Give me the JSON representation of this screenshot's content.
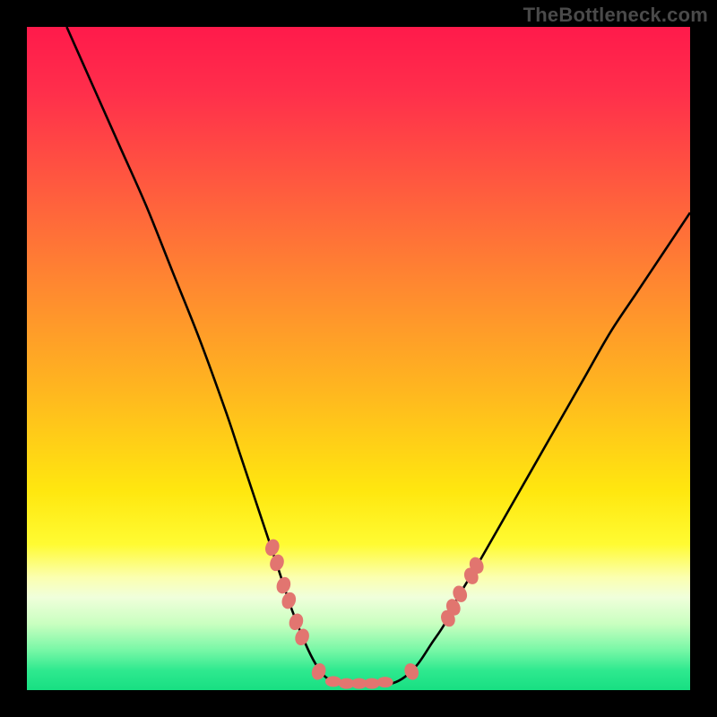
{
  "attribution": "TheBottleneck.com",
  "colors": {
    "frame": "#000000",
    "curve": "#000000",
    "marker_a": "#e27570",
    "marker_b": "#e1756f",
    "gradient_stops": [
      {
        "offset": 0.0,
        "color": "#ff1a4b"
      },
      {
        "offset": 0.1,
        "color": "#ff2f4b"
      },
      {
        "offset": 0.25,
        "color": "#ff5d3e"
      },
      {
        "offset": 0.4,
        "color": "#ff8b2f"
      },
      {
        "offset": 0.55,
        "color": "#ffb71f"
      },
      {
        "offset": 0.7,
        "color": "#ffe70f"
      },
      {
        "offset": 0.78,
        "color": "#fffb32"
      },
      {
        "offset": 0.83,
        "color": "#fbffb0"
      },
      {
        "offset": 0.86,
        "color": "#f0ffdb"
      },
      {
        "offset": 0.9,
        "color": "#c9ffc0"
      },
      {
        "offset": 0.94,
        "color": "#77f7a6"
      },
      {
        "offset": 0.97,
        "color": "#2fe98f"
      },
      {
        "offset": 1.0,
        "color": "#17df82"
      }
    ]
  },
  "chart_data": {
    "type": "line",
    "title": "",
    "xlabel": "",
    "ylabel": "",
    "xlim": [
      0,
      100
    ],
    "ylim": [
      0,
      100
    ],
    "series": [
      {
        "name": "curve-left",
        "x": [
          6,
          10,
          14,
          18,
          22,
          26,
          30,
          32,
          34,
          36,
          38,
          40,
          42,
          43.5,
          45
        ],
        "y": [
          100,
          91,
          82,
          73,
          63,
          53,
          42,
          36,
          30,
          24,
          18,
          12,
          7,
          4,
          2
        ]
      },
      {
        "name": "curve-bottom",
        "x": [
          45,
          47,
          49,
          51,
          53,
          55,
          57
        ],
        "y": [
          2,
          1,
          1,
          1,
          1,
          1,
          2
        ]
      },
      {
        "name": "curve-right",
        "x": [
          57,
          59,
          61,
          63,
          65,
          68,
          72,
          76,
          80,
          84,
          88,
          92,
          96,
          100
        ],
        "y": [
          2,
          4,
          7,
          10,
          14,
          19,
          26,
          33,
          40,
          47,
          54,
          60,
          66,
          72
        ]
      }
    ],
    "markers_left": [
      {
        "x": 37.0,
        "y": 21.5
      },
      {
        "x": 37.7,
        "y": 19.2
      },
      {
        "x": 38.7,
        "y": 15.8
      },
      {
        "x": 39.5,
        "y": 13.5
      },
      {
        "x": 40.6,
        "y": 10.3
      },
      {
        "x": 41.5,
        "y": 8.0
      },
      {
        "x": 44.0,
        "y": 2.8
      }
    ],
    "markers_bottom": [
      {
        "x": 46.2,
        "y": 1.3
      },
      {
        "x": 48.2,
        "y": 1.0
      },
      {
        "x": 50.1,
        "y": 1.0
      },
      {
        "x": 52.0,
        "y": 1.0
      },
      {
        "x": 54.0,
        "y": 1.2
      }
    ],
    "markers_right": [
      {
        "x": 58.0,
        "y": 2.8
      },
      {
        "x": 63.5,
        "y": 10.8
      },
      {
        "x": 64.3,
        "y": 12.5
      },
      {
        "x": 65.3,
        "y": 14.5
      },
      {
        "x": 67.0,
        "y": 17.2
      },
      {
        "x": 67.8,
        "y": 18.8
      }
    ]
  }
}
